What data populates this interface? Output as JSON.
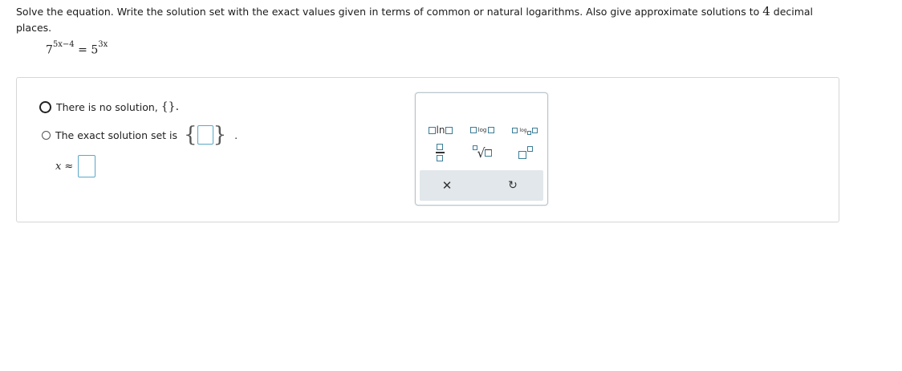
{
  "prompt": {
    "text_before": "Solve the equation. Write the solution set with the exact values given in terms of common or natural logarithms. Also give approximate solutions to ",
    "decimal_places": "4",
    "text_after": " decimal places."
  },
  "equation": {
    "base_left": "7",
    "exp_left": "5x−4",
    "equals": "=",
    "base_right": "5",
    "exp_right": "3x"
  },
  "options": {
    "no_solution": {
      "label": "There is no solution,",
      "set": "{}."
    },
    "exact_solution": {
      "label": "The exact solution set is",
      "period": "."
    }
  },
  "approx": {
    "var": "x",
    "symbol": "≈"
  },
  "keypad": {
    "ln_label": "ln",
    "log_label": "log",
    "logb_label": "log",
    "sqrt_symbol": "√",
    "clear_symbol": "✕",
    "undo_symbol": "↻",
    "accent_color": "#3a7d98"
  }
}
